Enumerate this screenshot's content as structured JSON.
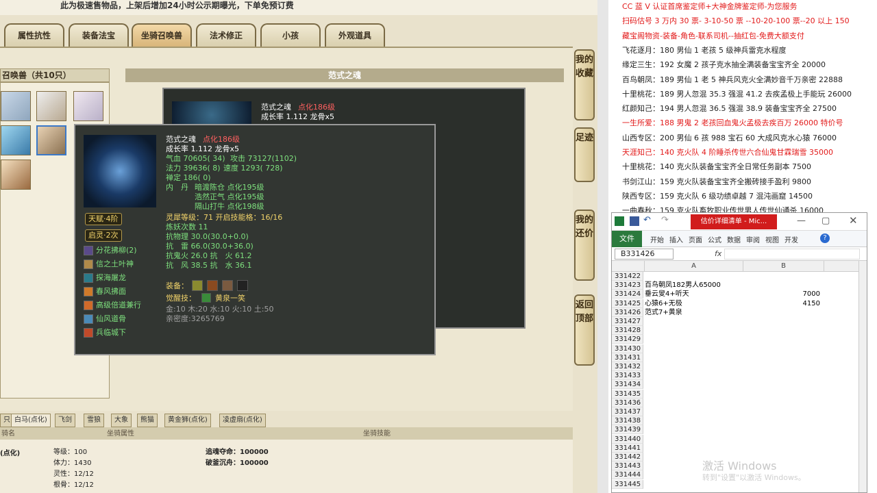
{
  "game": {
    "notice": "此为极速售物品，上架后增加24小时公示期曝光，下单免预订费",
    "tabs": [
      "属性抗性",
      "装备法宝",
      "坐骑召唤兽",
      "法术修正",
      "小孩",
      "外观道具"
    ],
    "pet_list_title": "召唤兽（共10只）",
    "pet_name_header": "范式之魂",
    "side_buttons": [
      "我的收藏",
      "足迹",
      "我的还价",
      "返回顶部"
    ]
  },
  "tooltip_back": {
    "name": "范式之魂",
    "tag": "点化186级",
    "growth": "成长率 1.112 龙骨x5"
  },
  "tooltip": {
    "name": "范式之魂",
    "tag": "点化186级",
    "growth": "成长率 1.112 龙骨x5",
    "hp_label": "气血 70605( 34)",
    "atk_label": "攻击 73127(1102)",
    "mp_label": "法力 39636( 8)",
    "spd_label": "速度 1293( 728)",
    "zen_label": "禅定 186( 0)",
    "neidan_label": "内　丹",
    "neidan": [
      "暗渡陈仓 点化195级",
      "浩然正气 点化195级",
      "隔山打牛 点化198级"
    ],
    "talent": "天赋·4阶",
    "spirit": "启灵·2次",
    "lingxi": "灵犀等级：71 开启技能格：16/16",
    "lianyao": "炼妖次数 11",
    "resist": [
      "抗物理 30.0(30.0+0.0)",
      "抗　雷 66.0(30.0+36.0)",
      "抗鬼火 26.0 抗　火 61.2",
      "抗　风 38.5 抗　水 36.1"
    ],
    "equip_label": "装备：",
    "awaken_label": "觉醒技：",
    "awaken_skill": "黄泉一笑",
    "elements": "金:10 木:20 水:10 火:10 土:50",
    "intimacy": "亲密度:3265769",
    "skills": [
      "分花拂柳(2)",
      "信之土叶神",
      "探海屠龙",
      "春风拂面",
      "高级倍道兼行",
      "仙风道骨",
      "兵临城下"
    ]
  },
  "bottom": {
    "tabs": [
      "只",
      "白马(点化)",
      "飞剑",
      "雪狼",
      "大象",
      "熊猫",
      "黄金狮(点化)",
      "凌虚扇(点化)"
    ],
    "headers": [
      "骑名",
      "坐骑属性",
      "坐骑技能"
    ],
    "mount_name": "(点化)",
    "attrs": [
      "等级：100",
      "体力：1430",
      "灵性：12/12",
      "根骨：12/12"
    ],
    "skills": [
      "追魂夺命：100000",
      "破釜沉舟：100000"
    ]
  },
  "sell_info": [
    {
      "text": "CC 蓝 V 认证首席鉴定师+大神金牌鉴定师-为您服务",
      "color": "#e21a1a"
    },
    {
      "text": "扫码估号 3 万内 30 票- 3-10-50 票 --10-20-100 票--20 以上 150",
      "color": "#e21a1a"
    },
    {
      "text": "藏宝阁物资-装备-角色-联系司机--抽红包-免费大额支付",
      "color": "#e21a1a"
    },
    {
      "text": "飞花逐月：180 男仙 1 老孩 5 级神兵雷克水程度",
      "color": "#222222"
    },
    {
      "text": "缘定三生：192 女魔 2 孩子克水抽全满装备宝宝齐全 20000",
      "color": "#222222"
    },
    {
      "text": "百鸟朝凤：189 男仙 1 老 5 神兵风克火全满妙音千万亲密 22888",
      "color": "#222222"
    },
    {
      "text": "十里桃花：189 男人忽混 35.3 强混 41.2 去疾孟极上手能玩 26000",
      "color": "#222222"
    },
    {
      "text": "红颜知己：194 男人忽混 36.5 强混 38.9 装备宝宝齐全 27500",
      "color": "#222222"
    },
    {
      "text": "一生所爱：188 男鬼 2 老孩回血鬼火孟极去疾百万 26000 特价号",
      "color": "#e21a1a"
    },
    {
      "text": "山西专区：200 男仙 6 孩 988 宝石 60 大成风克水心猿 76000",
      "color": "#222222"
    },
    {
      "text": "天涯知己：140 克火队 4 阶睡杀传世六合仙鬼甘霖瑞雪 35000",
      "color": "#e21a1a"
    },
    {
      "text": "十里桃花：140 克火队装备宝宝齐全日常任务副本 7500",
      "color": "#222222"
    },
    {
      "text": "书剑江山：159 克火队装备宝宝齐全搬砖接手盈利 9800",
      "color": "#222222"
    },
    {
      "text": "陕西专区：159 克火队 6 级功绩卓越 7 混沌画窟 14500",
      "color": "#222222"
    },
    {
      "text": "一曲春秋：159 克火队畜牧职业传世男人传世仙通杀 16000",
      "color": "#222222"
    }
  ],
  "excel": {
    "title": "估价详细清单 - Mic...",
    "file_tab": "文件",
    "ribbon_tabs": [
      "开始",
      "插入",
      "页面",
      "公式",
      "数据",
      "审阅",
      "视图",
      "开发"
    ],
    "name_box": "B331426",
    "fx": "fx",
    "columns": [
      "A",
      "B"
    ],
    "rows": [
      {
        "num": "331422",
        "a": "",
        "b": ""
      },
      {
        "num": "331423",
        "a": "百鸟朝凤182男人65000",
        "b": ""
      },
      {
        "num": "331424",
        "a": "垂云叟4+听天",
        "b": "7000"
      },
      {
        "num": "331425",
        "a": "心猿6+无极",
        "b": "4150"
      },
      {
        "num": "331426",
        "a": "范式7+黄泉",
        "b": ""
      },
      {
        "num": "331427",
        "a": "",
        "b": ""
      },
      {
        "num": "331428",
        "a": "",
        "b": ""
      },
      {
        "num": "331429",
        "a": "",
        "b": ""
      },
      {
        "num": "331430",
        "a": "",
        "b": ""
      },
      {
        "num": "331431",
        "a": "",
        "b": ""
      },
      {
        "num": "331432",
        "a": "",
        "b": ""
      },
      {
        "num": "331433",
        "a": "",
        "b": ""
      },
      {
        "num": "331434",
        "a": "",
        "b": ""
      },
      {
        "num": "331435",
        "a": "",
        "b": ""
      },
      {
        "num": "331436",
        "a": "",
        "b": ""
      },
      {
        "num": "331437",
        "a": "",
        "b": ""
      },
      {
        "num": "331438",
        "a": "",
        "b": ""
      },
      {
        "num": "331439",
        "a": "",
        "b": ""
      },
      {
        "num": "331440",
        "a": "",
        "b": ""
      },
      {
        "num": "331441",
        "a": "",
        "b": ""
      },
      {
        "num": "331442",
        "a": "",
        "b": ""
      },
      {
        "num": "331443",
        "a": "",
        "b": ""
      },
      {
        "num": "331444",
        "a": "",
        "b": ""
      },
      {
        "num": "331445",
        "a": "",
        "b": ""
      }
    ],
    "watermark": "激活 Windows",
    "watermark_sub": "转到\"设置\"以激活 Windows。"
  }
}
